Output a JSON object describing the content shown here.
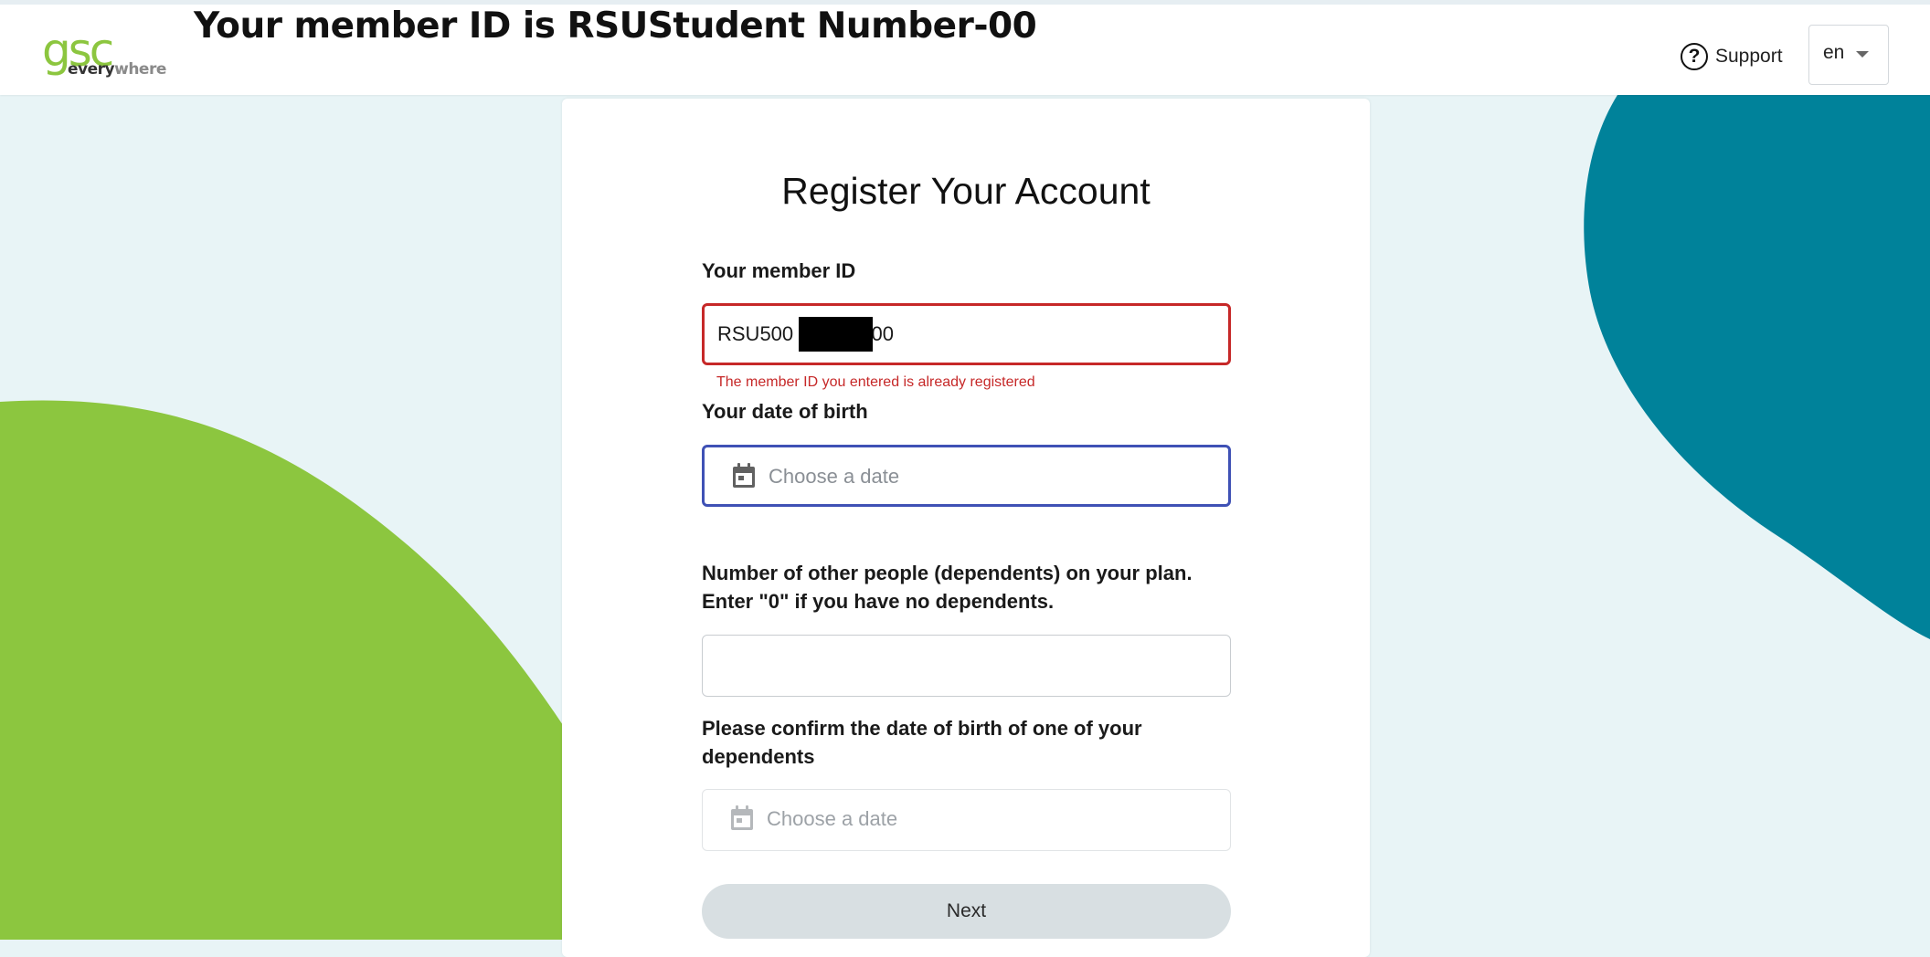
{
  "header": {
    "logo": {
      "primary": "gsc",
      "secondary_bold": "every",
      "secondary_light": "where"
    },
    "banner": "Your member ID is RSUStudent Number-00",
    "support_label": "Support",
    "language": {
      "selected": "en"
    }
  },
  "form": {
    "title": "Register Your Account",
    "member_id": {
      "label": "Your member ID",
      "value_prefix": "RSU500",
      "value_suffix": "-00",
      "redacted": true,
      "error": "The member ID you entered is already registered"
    },
    "dob": {
      "label": "Your date of birth",
      "placeholder": "Choose a date"
    },
    "dependents": {
      "label_line1": "Number of other people (dependents) on your plan.",
      "label_line2": "Enter \"0\" if you have no dependents.",
      "value": ""
    },
    "dependent_dob": {
      "label_line1": "Please confirm the date of birth of one of your",
      "label_line2": "dependents",
      "placeholder": "Choose a date"
    },
    "next_label": "Next"
  },
  "colors": {
    "brand_green": "#8cc63f",
    "brand_teal": "#00829a",
    "background": "#e8f4f6",
    "error": "#c62828",
    "focus": "#3f51b5",
    "button_disabled": "#d8dfe2"
  },
  "icons": [
    "help-circle-icon",
    "chevron-down-icon",
    "calendar-icon"
  ]
}
